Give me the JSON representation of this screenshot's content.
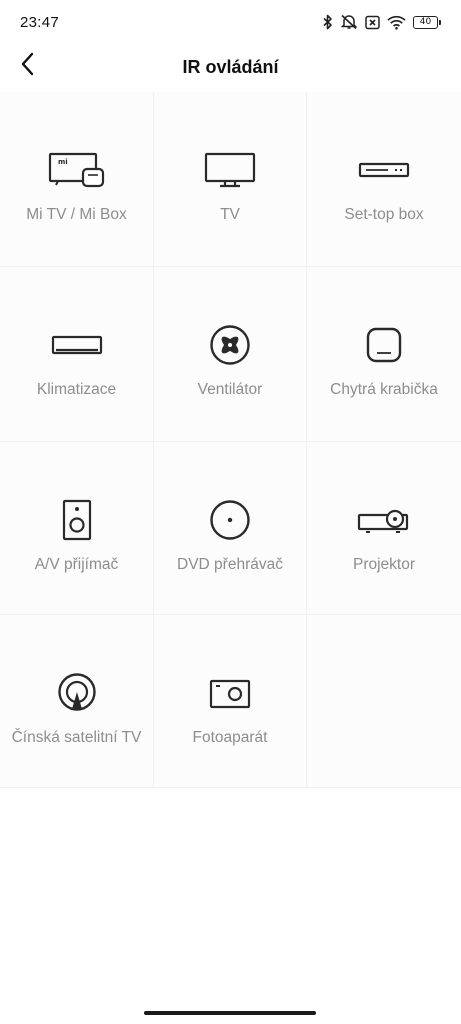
{
  "status": {
    "time": "23:47",
    "battery": "40",
    "icons": [
      "bluetooth-icon",
      "muted-vibrate-icon",
      "no-sim-icon",
      "wifi-icon",
      "battery-icon"
    ]
  },
  "header": {
    "title": "IR ovládání",
    "back_icon": "chevron-left-icon"
  },
  "devices": [
    {
      "label": "Mi TV / Mi Box",
      "icon": "mi-tv-box-icon"
    },
    {
      "label": "TV",
      "icon": "tv-icon"
    },
    {
      "label": "Set-top box",
      "icon": "set-top-box-icon"
    },
    {
      "label": "Klimatizace",
      "icon": "air-conditioner-icon"
    },
    {
      "label": "Ventilátor",
      "icon": "fan-icon"
    },
    {
      "label": "Chytrá krabička",
      "icon": "smart-box-icon"
    },
    {
      "label": "A/V přijímač",
      "icon": "speaker-icon"
    },
    {
      "label": "DVD přehrávač",
      "icon": "disc-icon"
    },
    {
      "label": "Projektor",
      "icon": "projector-icon"
    },
    {
      "label": "Čínská satelitní TV",
      "icon": "satellite-icon"
    },
    {
      "label": "Fotoaparát",
      "icon": "camera-icon"
    }
  ],
  "colors": {
    "label": "#8d8d8d",
    "icon": "#2a2a2a",
    "title": "#111111",
    "cell_background": "#fdfcfc"
  }
}
